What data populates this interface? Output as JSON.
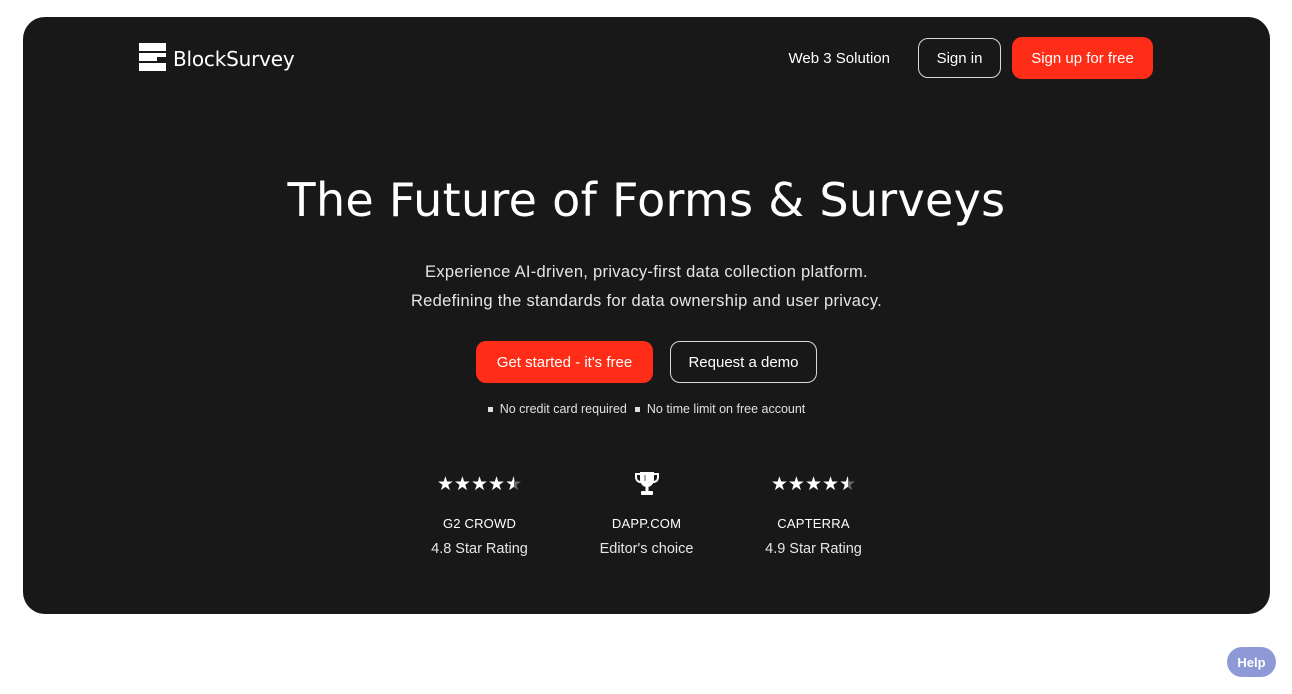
{
  "header": {
    "logo_text": "BlockSurvey",
    "nav_link": "Web 3 Solution",
    "sign_in": "Sign in",
    "sign_up": "Sign up for free"
  },
  "hero": {
    "title": "The Future of Forms & Surveys",
    "subtitle_line1": "Experience AI-driven, privacy-first data collection platform.",
    "subtitle_line2": "Redefining the standards for data ownership and user privacy.",
    "primary_cta": "Get started - it's free",
    "secondary_cta": "Request a demo",
    "notes": [
      "No credit card required",
      "No time limit on free account"
    ]
  },
  "ratings": [
    {
      "source": "G2 CROWD",
      "value": "4.8 Star Rating",
      "icon": "star-rating-icon",
      "stars": 4.5
    },
    {
      "source": "DAPP.COM",
      "value": "Editor's choice",
      "icon": "trophy-icon"
    },
    {
      "source": "CAPTERRA",
      "value": "4.9 Star Rating",
      "icon": "star-rating-icon",
      "stars": 4.5
    }
  ],
  "help_button": "Help",
  "colors": {
    "hero_background": "#181818",
    "accent_red": "#ff2d17",
    "help_bubble": "#8e9ad8"
  }
}
